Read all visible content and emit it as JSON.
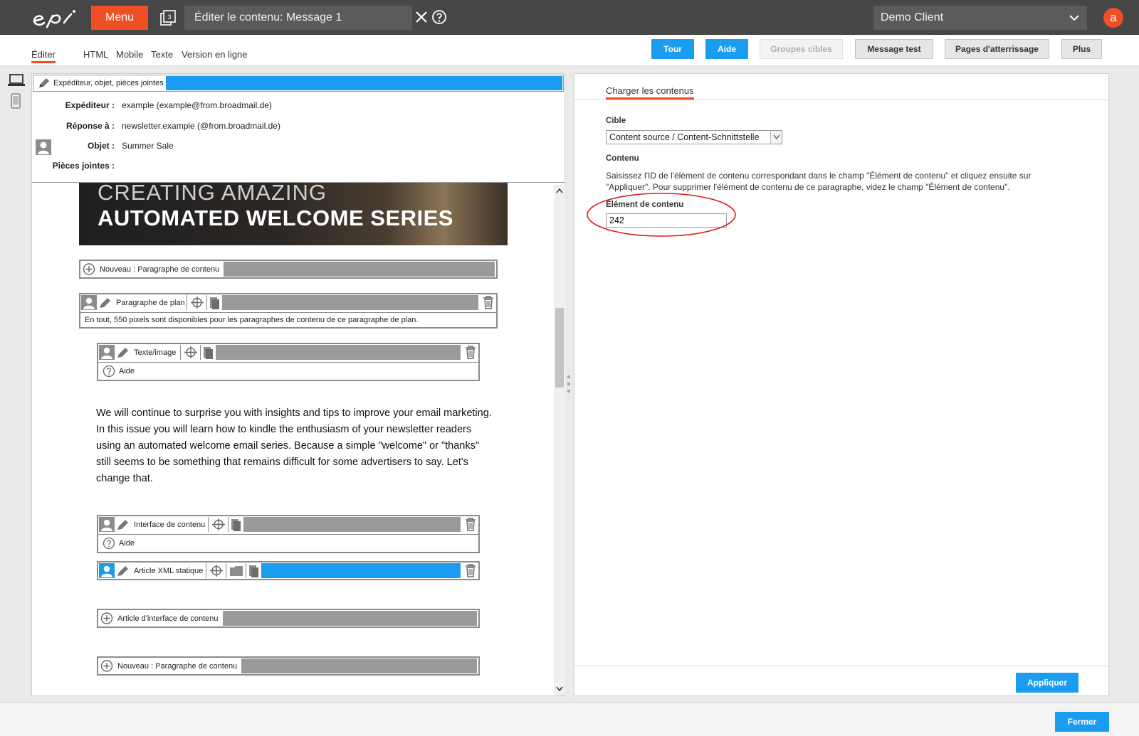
{
  "header": {
    "menu_label": "Menu",
    "tabs_count": "3",
    "title": "Éditer le contenu: Message 1",
    "client": "Demo Client",
    "avatar_letter": "a",
    "accent_color": "#f04e23",
    "primary_color": "#1a9cf0"
  },
  "toolbar": {
    "tabs": [
      {
        "label": "Éditer",
        "active": true
      },
      {
        "label": "HTML"
      },
      {
        "label": "Mobile"
      },
      {
        "label": "Texte"
      },
      {
        "label": "Version en ligne"
      }
    ],
    "buttons": [
      {
        "label": "Tour",
        "style": "primary"
      },
      {
        "label": "Aide",
        "style": "primary"
      },
      {
        "label": "Groupes cibles",
        "style": "disabled"
      },
      {
        "label": "Message test",
        "style": "secondary"
      },
      {
        "label": "Pages d'atterrissage",
        "style": "secondary"
      },
      {
        "label": "Plus",
        "style": "secondary"
      }
    ]
  },
  "envelope": {
    "header_label": "Expéditeur, objet, pièces jointes",
    "rows": [
      {
        "key": "Expéditeur :",
        "value": "example (example@from.broadmail.de)"
      },
      {
        "key": "Réponse à :",
        "value": "newsletter.example (@from.broadmail.de)"
      },
      {
        "key": "Objet :",
        "value": "Summer Sale"
      },
      {
        "key": "Pièces jointes :",
        "value": ""
      }
    ]
  },
  "banner": {
    "line1": "CREATING AMAZING",
    "line2": "AUTOMATED WELCOME SERIES"
  },
  "blocks": {
    "new_para_1": "Nouveau : Paragraphe de contenu",
    "layout_para": "Paragraphe de plan",
    "layout_note": "En tout, 550 pixels sont disponibles pour les paragraphes de contenu de ce paragraphe de plan.",
    "text_image": "Texte/image",
    "help_1": "Aide",
    "content_interface": "Interface de contenu",
    "help_2": "Aide",
    "xml_article": "Article XML statique",
    "interface_article": "Article d'interface de contenu",
    "new_para_2": "Nouveau : Paragraphe de contenu"
  },
  "body_text": "We will continue to surprise you with insights and tips to improve your email marketing. In this issue you will learn how to kindle the enthusiasm of your newsletter readers using an automated welcome email series. Because a simple \"welcome\" or \"thanks\" still seems to be something that remains difficult for some advertisers to say. Let's change that.",
  "right_panel": {
    "tab_label": "Charger les contenus",
    "target_label": "Cible",
    "target_value": "Content source / Content-Schnittstelle",
    "content_label": "Contenu",
    "content_desc": "Saisissez l'ID de l'élément de contenu correspondant dans le champ \"Élément de contenu\" et cliquez ensuite sur \"Appliquer\". Pour supprimer l'élément de contenu de ce paragraphe, videz le champ \"Élément de contenu\".",
    "element_label": "Élément de contenu",
    "element_value": "242",
    "apply_label": "Appliquer"
  },
  "footer": {
    "close_label": "Fermer"
  }
}
